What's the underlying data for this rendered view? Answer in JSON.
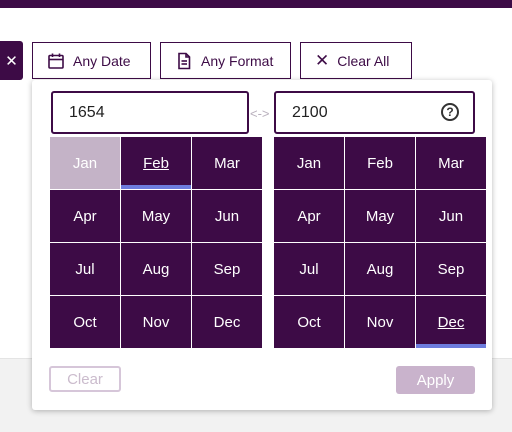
{
  "toolbar": {
    "close_glyph": "✕",
    "any_date_label": "Any Date",
    "any_format_label": "Any Format",
    "clear_all_label": "Clear All"
  },
  "date_picker": {
    "from_value": "1654",
    "to_value": "2100",
    "range_arrow": "<->",
    "help_glyph": "?",
    "from_months": [
      "Jan",
      "Feb",
      "Mar",
      "Apr",
      "May",
      "Jun",
      "Jul",
      "Aug",
      "Sep",
      "Oct",
      "Nov",
      "Dec"
    ],
    "to_months": [
      "Jan",
      "Feb",
      "Mar",
      "Apr",
      "May",
      "Jun",
      "Jul",
      "Aug",
      "Sep",
      "Oct",
      "Nov",
      "Dec"
    ],
    "from_selected": "Feb",
    "from_disabled": "Jan",
    "to_selected": "Dec",
    "clear_label": "Clear",
    "apply_label": "Apply"
  },
  "colors": {
    "brand": "#3d0b46",
    "selected_indicator": "#6d7cdd",
    "disabled": "#c4b3c7"
  }
}
